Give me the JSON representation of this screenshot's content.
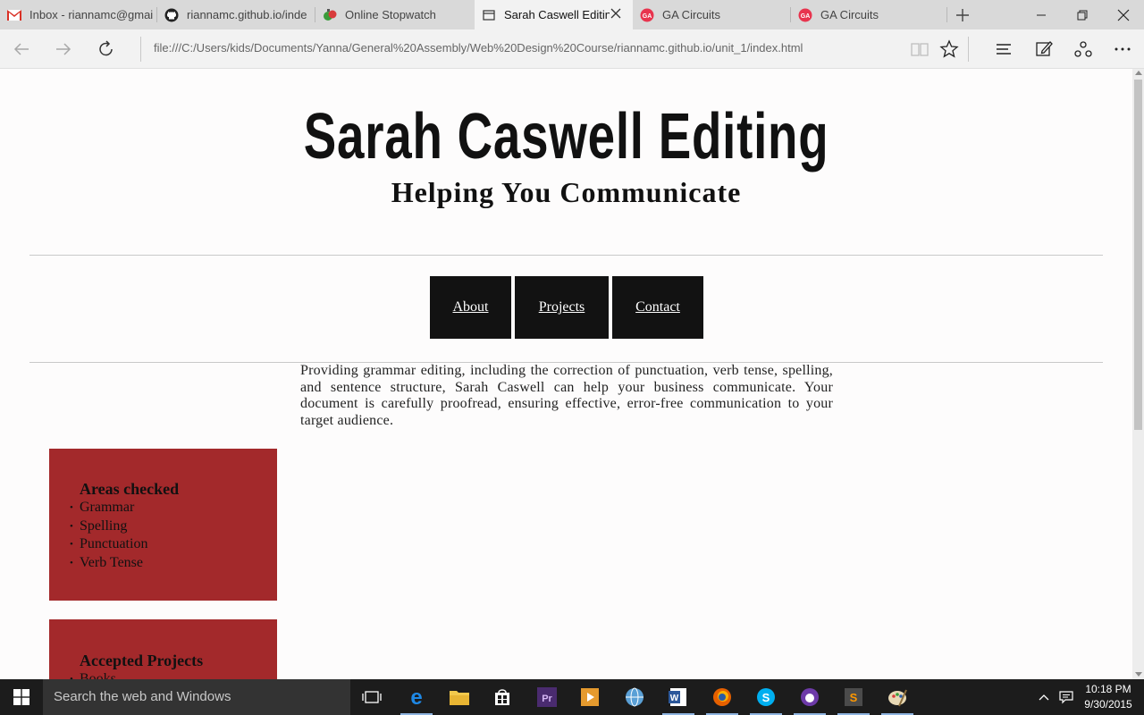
{
  "browser": {
    "tabs": [
      {
        "title": "Inbox - riannamc@gmai",
        "icon": "gmail-icon"
      },
      {
        "title": "riannamc.github.io/inde",
        "icon": "github-icon"
      },
      {
        "title": "Online Stopwatch",
        "icon": "stopwatch-icon"
      },
      {
        "title": "Sarah Caswell Editin",
        "icon": "page-icon",
        "active": true
      },
      {
        "title": "GA Circuits",
        "icon": "ga-icon"
      },
      {
        "title": "GA Circuits",
        "icon": "ga-icon"
      }
    ],
    "address": "file:///C:/Users/kids/Documents/Yanna/General%20Assembly/Web%20Design%20Course/riannamc.github.io/unit_1/index.html"
  },
  "page": {
    "title": "Sarah Caswell Editing",
    "subtitle": "Helping You Communicate",
    "nav": [
      {
        "label": "About"
      },
      {
        "label": "Projects"
      },
      {
        "label": "Contact"
      }
    ],
    "intro": "Providing grammar editing, including the correction of punctuation, verb tense, spelling, and sentence structure, Sarah Caswell can help your business communicate. Your document is carefully proofread, ensuring effective, error-free communication to your target audience.",
    "cards": [
      {
        "heading": "Areas checked",
        "items": [
          "Grammar",
          "Spelling",
          "Punctuation",
          "Verb Tense"
        ]
      },
      {
        "heading": "Accepted Projects",
        "items": [
          "Books"
        ]
      }
    ]
  },
  "taskbar": {
    "search_placeholder": "Search the web and Windows",
    "time": "10:18 PM",
    "date": "9/30/2015"
  },
  "colors": {
    "card_bg": "#a3292b",
    "nav_bg": "#121212",
    "taskbar_bg": "#1c1c1c"
  }
}
